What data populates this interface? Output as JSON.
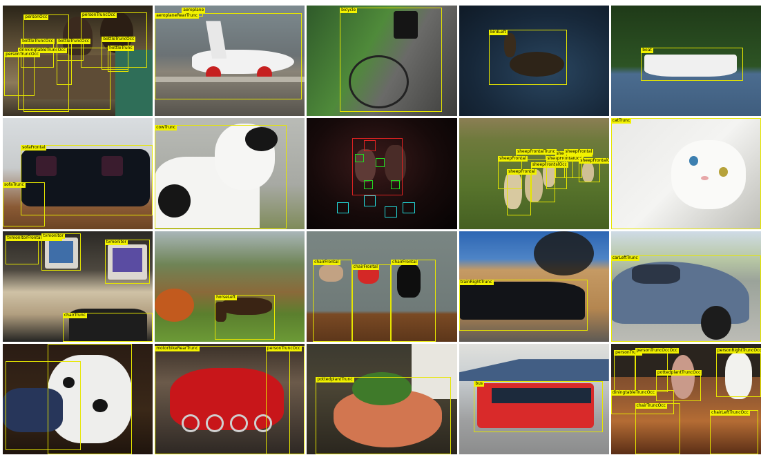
{
  "tiles": [
    {
      "labels": [
        "personOcc",
        "personTruncOcc",
        "bottleTruncOcc",
        "bottleTrunc",
        "bottleTruncOcc",
        "bottle",
        "drinkingtableTruncOcc",
        "bottleTruncOcc",
        "personTruncOcc"
      ]
    },
    {
      "labels": [
        "aeroplane",
        "aeroplaneRearTrunc"
      ]
    },
    {
      "labels": [
        "bicycle"
      ]
    },
    {
      "labels": [
        "birdLeft"
      ]
    },
    {
      "labels": [
        "boat"
      ]
    },
    {
      "labels": [
        "sofaFrontal",
        "sofaTrunc"
      ]
    },
    {
      "labels": [
        "cowTrunc"
      ]
    },
    {
      "labels": []
    },
    {
      "labels": [
        "sheepFrontalTrunc",
        "sheepFrontal",
        "sheepFrontal",
        "sheepFrontalOcc",
        "sheepFrontalOcc",
        "sheepFrontalOcc",
        "sheepFrontal",
        "sheepFrontalOcc"
      ]
    },
    {
      "labels": [
        "catTrunc"
      ]
    },
    {
      "labels": [
        "tvmonitorFrontalTruncOcc",
        "tvmonitor",
        "tvmonitor",
        "chairTrunc"
      ]
    },
    {
      "labels": [
        "horseLeft"
      ]
    },
    {
      "labels": [
        "chairFrontal",
        "chairFrontal",
        "chairFrontal"
      ]
    },
    {
      "labels": [
        "trainRightTrunc"
      ]
    },
    {
      "labels": [
        "carLeftTrunc"
      ]
    },
    {
      "labels": []
    },
    {
      "labels": [
        "motorbikeRearTrunc",
        "personTruncOcc"
      ]
    },
    {
      "labels": [
        "pottedplantTrunc"
      ]
    },
    {
      "labels": [
        "bus"
      ]
    },
    {
      "labels": [
        "personTrunc",
        "personTruncOccOcc",
        "personRightTruncOcc",
        "pottedplantTruncOcc",
        "diningtableTruncOcc",
        "chairTruncOcc",
        "chairLeftTruncOcc"
      ]
    }
  ]
}
